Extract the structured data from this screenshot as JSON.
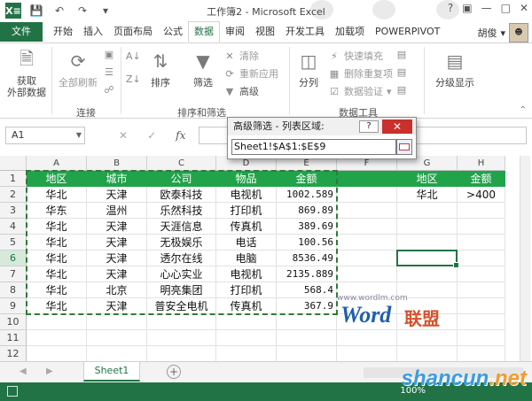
{
  "app": {
    "title": "工作簿2 - Microsoft Excel",
    "logo_text": "X≡",
    "user": "胡俊"
  },
  "quick_access": [
    "save-icon",
    "undo-icon",
    "redo-icon"
  ],
  "ribbon_tabs": [
    {
      "label": "文件",
      "type": "file"
    },
    {
      "label": "开始"
    },
    {
      "label": "插入"
    },
    {
      "label": "页面布局"
    },
    {
      "label": "公式"
    },
    {
      "label": "数据",
      "active": true
    },
    {
      "label": "审阅"
    },
    {
      "label": "视图"
    },
    {
      "label": "开发工具"
    },
    {
      "label": "加载项"
    },
    {
      "label": "POWERPIVOT"
    }
  ],
  "ribbon": {
    "get_external": "获取\n外部数据",
    "refresh_all": "全部刷新",
    "connections_group": "连接",
    "sort": "排序",
    "filter": "筛选",
    "clear": "清除",
    "reapply": "重新应用",
    "advanced": "高级",
    "sort_filter_group": "排序和筛选",
    "split_columns": "分列",
    "flash_fill": "快速填充",
    "remove_duplicates": "删除重复项",
    "data_validation": "数据验证",
    "data_tools_group": "数据工具",
    "outline": "分级显示"
  },
  "formula_bar": {
    "name_box": "A1",
    "fx": "fx"
  },
  "dialog": {
    "title": "高级筛选 - 列表区域:",
    "help": "?",
    "close": "✕",
    "value": "Sheet1!$A$1:$E$9"
  },
  "columns": [
    "A",
    "B",
    "C",
    "D",
    "E",
    "F",
    "G",
    "H"
  ],
  "rows": [
    "1",
    "2",
    "3",
    "4",
    "5",
    "6",
    "7",
    "8",
    "9",
    "10",
    "11",
    "12"
  ],
  "table": {
    "headers": [
      "地区",
      "城市",
      "公司",
      "物品",
      "金额"
    ],
    "data": [
      [
        "华北",
        "天津",
        "欧泰科技",
        "电视机",
        "1002.589"
      ],
      [
        "华东",
        "温州",
        "乐然科技",
        "打印机",
        "869.89"
      ],
      [
        "华北",
        "天津",
        "天涯信息",
        "传真机",
        "389.69"
      ],
      [
        "华北",
        "天津",
        "无极娱乐",
        "电话",
        "100.56"
      ],
      [
        "华北",
        "天津",
        "透尔在线",
        "电脑",
        "8536.49"
      ],
      [
        "华北",
        "天津",
        "心心实业",
        "电视机",
        "2135.889"
      ],
      [
        "华北",
        "北京",
        "明亮集团",
        "打印机",
        "568.4"
      ],
      [
        "华北",
        "天津",
        "普安全电机",
        "传真机",
        "367.9"
      ]
    ]
  },
  "criteria": {
    "headers": [
      "地区",
      "金额"
    ],
    "values": [
      "华北",
      ">400"
    ]
  },
  "sheet_tabs": [
    "Sheet1"
  ],
  "status": {
    "zoom": "100%"
  },
  "watermarks": {
    "url": "www.wordlm.com",
    "word": "Word",
    "lianmeng": "联盟",
    "shancun": "shancun",
    "shancun_tld": ".net"
  },
  "colors": {
    "excel_green": "#217346",
    "header_fill": "#21a34a"
  }
}
